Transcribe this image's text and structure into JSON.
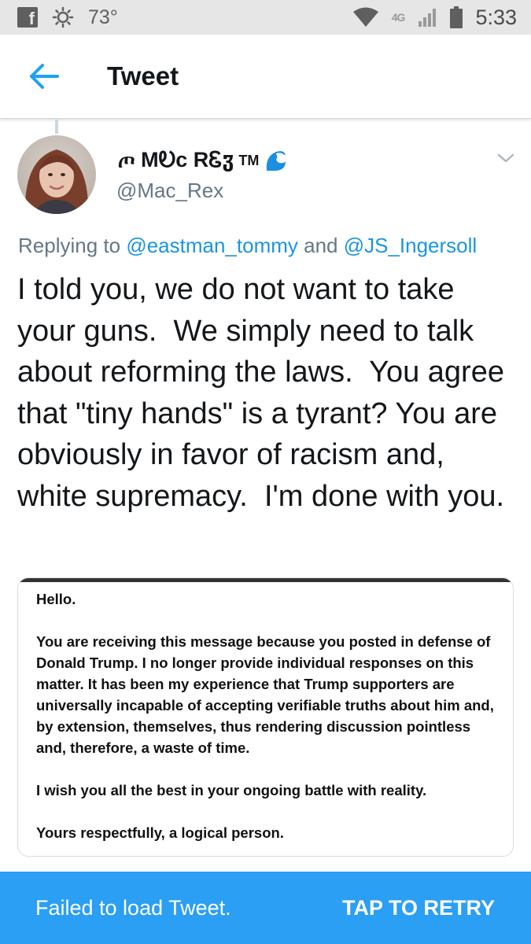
{
  "status_bar": {
    "temperature": "73°",
    "network": "4G",
    "time": "5:33",
    "icons": [
      "facebook-icon",
      "brightness-icon",
      "wifi-icon",
      "signal-icon",
      "battery-icon"
    ]
  },
  "toolbar": {
    "title": "Tweet",
    "back_icon": "arrow-left-icon"
  },
  "tweet": {
    "author": {
      "display_name": "ጦ MᎧc RᏋჳ",
      "tm": "TM",
      "emoji_icon": "water-wave-icon",
      "handle": "@Mac_Rex"
    },
    "replying_prefix": "Replying to ",
    "replying_user_1": "@eastman_tommy",
    "replying_and": " and ",
    "replying_user_2": "@JS_Ingersoll",
    "text": "I told you, we do not want to take your guns.  We simply need to talk about reforming the laws.  You agree that \"tiny hands\" is a tyrant? You are obviously in favor of racism and, white supremacy.  I'm done with you.",
    "media": {
      "greeting": "Hello.",
      "paragraph_1": "You are receiving this message because you posted in defense of Donald Trump. I no longer provide individual responses on this matter. It has been my experience that Trump supporters are universally incapable of accepting verifiable truths about him and, by extension, themselves, thus rendering discussion pointless and, therefore, a waste of time.",
      "paragraph_2": "I wish you all the best in your ongoing battle with reality.",
      "closing": "Yours respectfully, a logical person."
    }
  },
  "retry_bar": {
    "message": "Failed to load Tweet.",
    "action_label": "TAP TO RETRY"
  },
  "colors": {
    "accent": "#1da1f2",
    "link": "#1b95e0",
    "retry_background": "#2a9ff3",
    "secondary_text": "#657786"
  }
}
